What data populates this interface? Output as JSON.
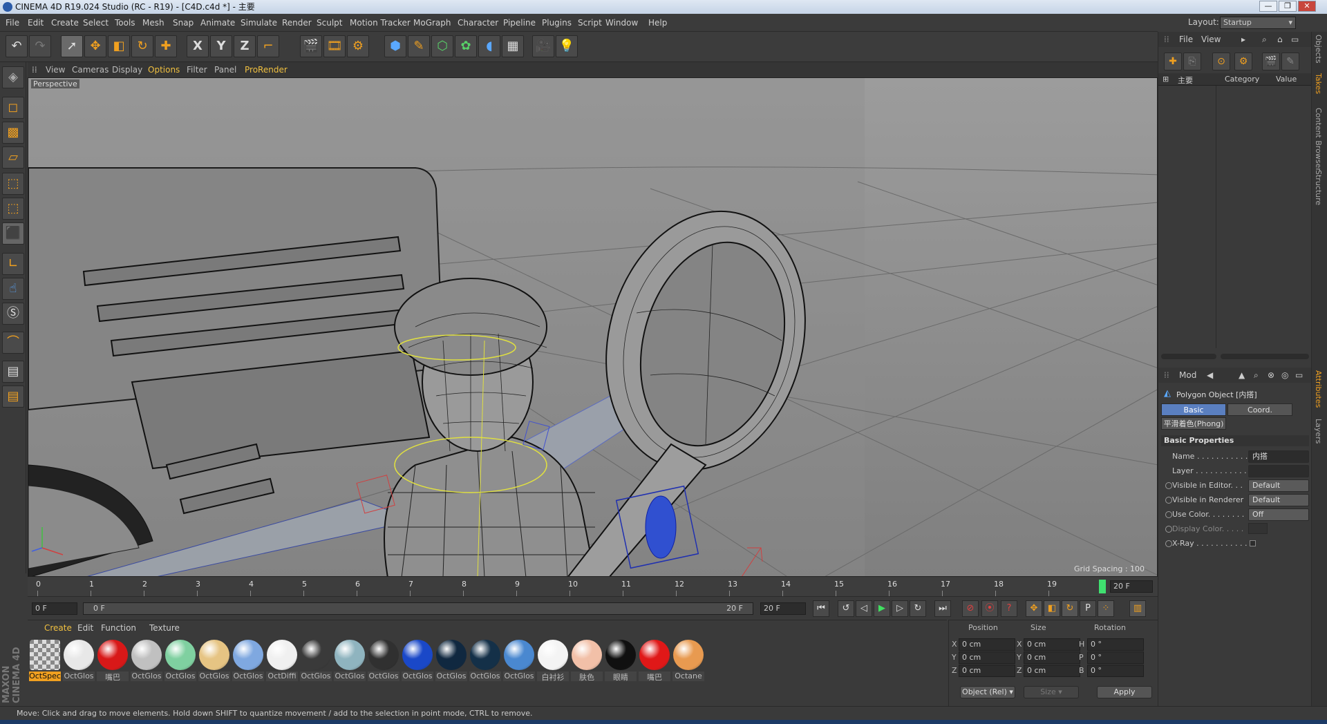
{
  "window": {
    "title": "CINEMA 4D R19.024 Studio (RC - R19) - [C4D.c4d *] - 主要",
    "layout_label": "Layout:",
    "layout_value": "Startup"
  },
  "menubar": {
    "items": [
      "File",
      "Edit",
      "Create",
      "Select",
      "Tools",
      "Mesh",
      "Snap",
      "Animate",
      "Simulate",
      "Render",
      "Sculpt",
      "Motion Tracker",
      "MoGraph",
      "Character",
      "Pipeline",
      "Plugins",
      "Script",
      "Window",
      "Help"
    ]
  },
  "toolbar": {
    "icons": [
      "undo-icon",
      "redo-icon",
      "live-selection-icon",
      "move-icon",
      "scale-icon",
      "rotate-icon",
      "recent-tool-icon",
      "x-axis-icon",
      "y-axis-icon",
      "z-axis-icon",
      "coordinate-system-icon",
      "render-view-icon",
      "render-picture-viewer-icon",
      "edit-render-settings-icon",
      "cube-icon",
      "pen-icon",
      "subdivision-icon",
      "array-icon",
      "deformer-icon",
      "floor-icon",
      "camera-icon",
      "light-icon"
    ],
    "axis_labels": [
      "X",
      "Y",
      "Z"
    ]
  },
  "viewport": {
    "menu": [
      "View",
      "Cameras",
      "Display",
      "Options",
      "Filter",
      "Panel",
      "ProRender"
    ],
    "camera_label": "Perspective",
    "grid_spacing": "Grid Spacing : 100 cm"
  },
  "timeline": {
    "ticks": [
      "0",
      "1",
      "2",
      "3",
      "4",
      "5",
      "6",
      "7",
      "8",
      "9",
      "10",
      "11",
      "12",
      "13",
      "14",
      "15",
      "16",
      "17",
      "18",
      "19"
    ],
    "current_frame": "20 F",
    "start_field": "0 F",
    "slider_start": "0 F",
    "slider_end": "20 F",
    "end_field": "20 F"
  },
  "materials": {
    "tabs": [
      "Create",
      "Edit",
      "Function",
      "Texture"
    ],
    "items": [
      {
        "label": "OctSpec",
        "color": "#c8c8c8"
      },
      {
        "label": "OctGlos",
        "color": "#e8e8e8"
      },
      {
        "label": "嘴巴",
        "color": "#d81818"
      },
      {
        "label": "OctGlos",
        "color": "#c0c0c0"
      },
      {
        "label": "OctGlos",
        "color": "#7fd0a0"
      },
      {
        "label": "OctGlos",
        "color": "#e6c483"
      },
      {
        "label": "OctGlos",
        "color": "#7fa8e0"
      },
      {
        "label": "OctDiffi",
        "color": "#f0f0f0"
      },
      {
        "label": "OctGlos",
        "color": "#3a3a3a"
      },
      {
        "label": "OctGlos",
        "color": "#8fb4bf"
      },
      {
        "label": "OctGlos",
        "color": "#303030"
      },
      {
        "label": "OctGlos",
        "color": "#1a48c8"
      },
      {
        "label": "OctGlos",
        "color": "#102840"
      },
      {
        "label": "OctGlos",
        "color": "#143048"
      },
      {
        "label": "OctGlos",
        "color": "#4a88d0"
      },
      {
        "label": "白衬衫",
        "color": "#f4f4f4"
      },
      {
        "label": "肤色",
        "color": "#f2c0a8"
      },
      {
        "label": "眼睛",
        "color": "#101010"
      },
      {
        "label": "嘴巴",
        "color": "#e01818"
      },
      {
        "label": "Octane",
        "color": "#e89a50"
      }
    ]
  },
  "coords": {
    "headers": [
      "Position",
      "Size",
      "Rotation"
    ],
    "rows": [
      {
        "axis": "X",
        "pos": "0 cm",
        "size_axis": "X",
        "size": "0 cm",
        "rot_axis": "H",
        "rot": "0 °"
      },
      {
        "axis": "Y",
        "pos": "0 cm",
        "size_axis": "Y",
        "size": "0 cm",
        "rot_axis": "P",
        "rot": "0 °"
      },
      {
        "axis": "Z",
        "pos": "0 cm",
        "size_axis": "Z",
        "size": "0 cm",
        "rot_axis": "B",
        "rot": "0 °"
      }
    ],
    "mode": "Object (Rel)",
    "size_mode": "Size",
    "apply": "Apply"
  },
  "status": {
    "text": "Move: Click and drag to move elements. Hold down SHIFT to quantize movement / add to the selection in point mode, CTRL to remove."
  },
  "objects_panel": {
    "menu": [
      "File",
      "View"
    ],
    "col_name": "主要",
    "col_category": "Category",
    "col_value": "Value"
  },
  "attributes": {
    "menu": "Mod",
    "object_title": "Polygon Object [内搭]",
    "tabs": [
      "Basic",
      "Coord."
    ],
    "phong_tab": "平滑着色(Phong)",
    "section": "Basic Properties",
    "rows": [
      {
        "label": "Name . . . . . . . . . . .",
        "value": "内搭"
      },
      {
        "label": "Layer . . . . . . . . . . .",
        "value": ""
      },
      {
        "label": "Visible in Editor. . .",
        "value": "Default"
      },
      {
        "label": "Visible in Renderer",
        "value": "Default"
      },
      {
        "label": "Use Color. . . . . . . .",
        "value": "Off"
      },
      {
        "label": "Display Color. . . . .",
        "value": ""
      },
      {
        "label": "X-Ray . . . . . . . . . . .",
        "value": ""
      }
    ]
  },
  "side_tabs": [
    "Objects",
    "Takes",
    "Content Browser",
    "Structure",
    "Attributes",
    "Layers"
  ],
  "brand": "MAXON CINEMA 4D",
  "colors": {
    "accent": "#f0a020",
    "highlight": "#f0c040",
    "selection": "#5a7fc0"
  }
}
